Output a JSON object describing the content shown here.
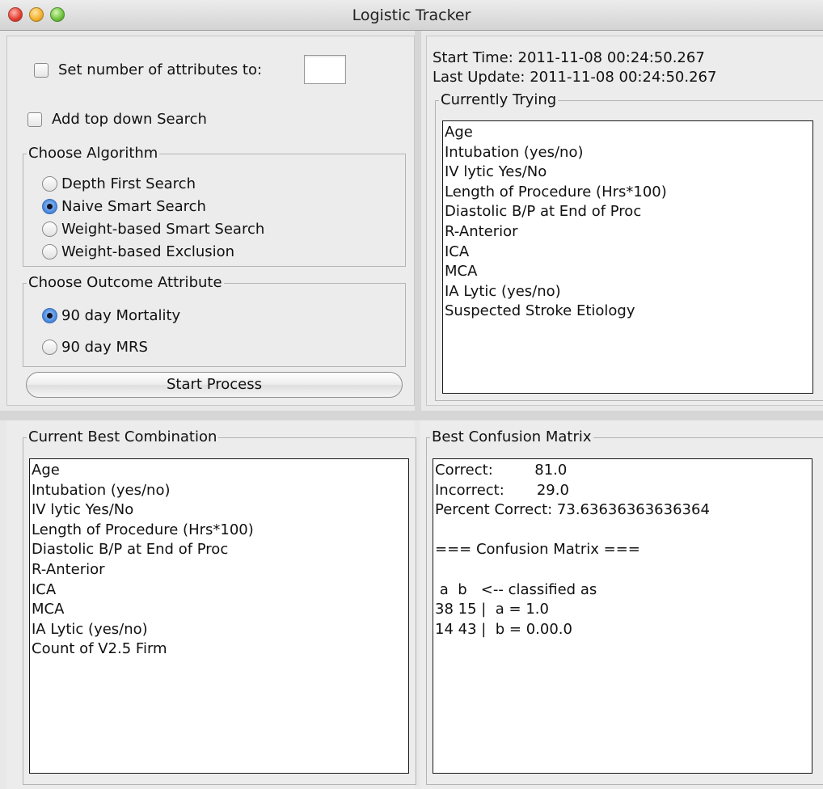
{
  "window": {
    "title": "Logistic Tracker"
  },
  "settings": {
    "set_attributes_label": "Set number of attributes to:",
    "set_attributes_value": "",
    "top_down_label": "Add top down Search"
  },
  "algorithm": {
    "legend": "Choose Algorithm",
    "options": [
      {
        "label": "Depth First Search",
        "selected": false
      },
      {
        "label": "Naive Smart Search",
        "selected": true
      },
      {
        "label": "Weight-based Smart Search",
        "selected": false
      },
      {
        "label": "Weight-based Exclusion",
        "selected": false
      }
    ]
  },
  "outcome": {
    "legend": "Choose Outcome Attribute",
    "options": [
      {
        "label": "90 day Mortality",
        "selected": true
      },
      {
        "label": "90 day MRS",
        "selected": false
      }
    ]
  },
  "start_button": "Start Process",
  "status": {
    "start_time": "Start Time:  2011-11-08 00:24:50.267",
    "last_update": "Last Update: 2011-11-08 00:24:50.267"
  },
  "currently_trying": {
    "legend": "Currently Trying",
    "items": [
      "Age",
      "Intubation (yes/no)",
      "IV lytic Yes/No",
      "Length of Procedure (Hrs*100)",
      "Diastolic B/P at End of Proc",
      "R-Anterior",
      "ICA",
      "MCA",
      "IA Lytic (yes/no)",
      "Suspected Stroke Etiology"
    ]
  },
  "best_combination": {
    "legend": "Current Best Combination",
    "items": [
      "Age",
      "Intubation (yes/no)",
      "IV lytic Yes/No",
      "Length of Procedure (Hrs*100)",
      "Diastolic B/P at End of Proc",
      "R-Anterior",
      "ICA",
      "MCA",
      "IA Lytic (yes/no)",
      "Count of V2.5 Firm"
    ]
  },
  "confusion_matrix": {
    "legend": "Best Confusion Matrix",
    "lines": [
      "Correct:         81.0",
      "Incorrect:       29.0",
      "Percent Correct: 73.63636363636364",
      "",
      "=== Confusion Matrix ===",
      "",
      " a  b   <-- classified as",
      "38 15 |  a = 1.0",
      "14 43 |  b = 0.00.0"
    ]
  }
}
